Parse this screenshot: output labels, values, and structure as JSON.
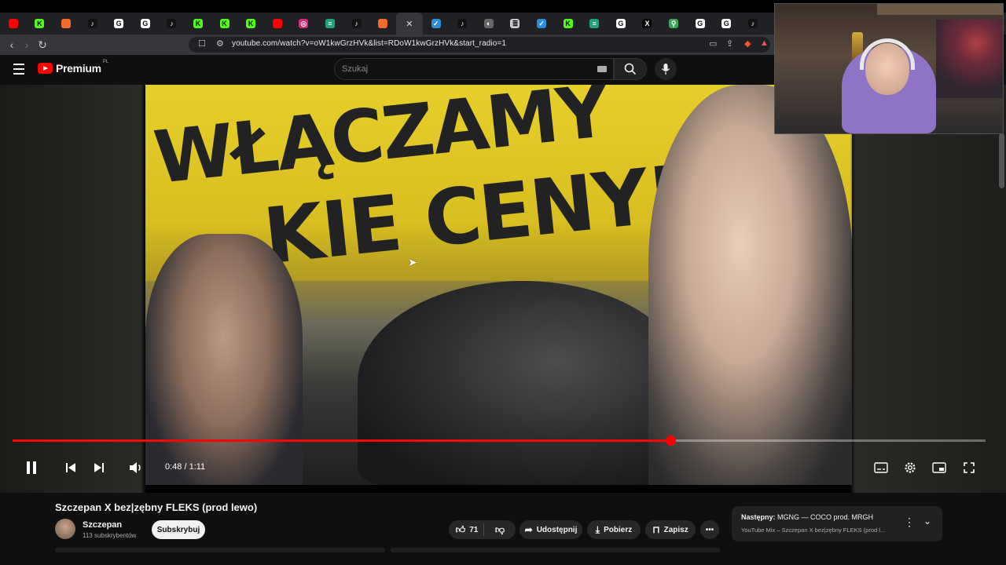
{
  "browser": {
    "tabs": [
      {
        "icon": "youtube-icon",
        "color": "#ff0000",
        "glyph": ""
      },
      {
        "icon": "kick-icon",
        "color": "#53fc18",
        "glyph": "K"
      },
      {
        "icon": "home-icon",
        "color": "#f26b2a",
        "glyph": ""
      },
      {
        "icon": "tiktok-icon",
        "color": "#111111",
        "glyph": "♪"
      },
      {
        "icon": "google-icon",
        "color": "#ffffff",
        "glyph": "G"
      },
      {
        "icon": "google-icon",
        "color": "#ffffff",
        "glyph": "G"
      },
      {
        "icon": "tiktok-icon",
        "color": "#111111",
        "glyph": "♪"
      },
      {
        "icon": "kick-icon",
        "color": "#53fc18",
        "glyph": "K"
      },
      {
        "icon": "kick-icon",
        "color": "#53fc18",
        "glyph": "K"
      },
      {
        "icon": "kick-icon",
        "color": "#53fc18",
        "glyph": "K"
      },
      {
        "icon": "youtube-icon",
        "color": "#ff0000",
        "glyph": ""
      },
      {
        "icon": "instagram-icon",
        "color": "#d62976",
        "glyph": "◎"
      },
      {
        "icon": "chat-icon",
        "color": "#1fa37a",
        "glyph": "≡"
      },
      {
        "icon": "tiktok-icon",
        "color": "#111111",
        "glyph": "♪"
      },
      {
        "icon": "home-icon",
        "color": "#f26b2a",
        "glyph": ""
      },
      {
        "icon": "active-tab",
        "color": "#35363a",
        "glyph": "✕"
      },
      {
        "icon": "bird-icon",
        "color": "#2a8fd8",
        "glyph": "✓"
      },
      {
        "icon": "tiktok-icon",
        "color": "#111111",
        "glyph": "♪"
      },
      {
        "icon": "globe-icon",
        "color": "#666666",
        "glyph": "◐"
      },
      {
        "icon": "stack-icon",
        "color": "#cccccc",
        "glyph": "≣"
      },
      {
        "icon": "bird-icon",
        "color": "#2a8fd8",
        "glyph": "✓"
      },
      {
        "icon": "kick-icon",
        "color": "#53fc18",
        "glyph": "K"
      },
      {
        "icon": "chat-icon",
        "color": "#1fa37a",
        "glyph": "≡"
      },
      {
        "icon": "google-icon",
        "color": "#ffffff",
        "glyph": "G"
      },
      {
        "icon": "x-icon",
        "color": "#000000",
        "glyph": "X"
      },
      {
        "icon": "maps-icon",
        "color": "#34a853",
        "glyph": "⚲"
      },
      {
        "icon": "google-icon",
        "color": "#ffffff",
        "glyph": "G"
      },
      {
        "icon": "google-icon",
        "color": "#ffffff",
        "glyph": "G"
      },
      {
        "icon": "tiktok-icon",
        "color": "#111111",
        "glyph": "♪"
      }
    ],
    "url": "youtube.com/watch?v=oW1kwGrzHVk&list=RDoW1kwGrzHVk&start_radio=1"
  },
  "header": {
    "logo_text": "Premium",
    "country": "PL",
    "search_placeholder": "Szukaj"
  },
  "player": {
    "sign_line1": "WŁĄCZAMY",
    "sign_line2": "KIE CENY!",
    "time": "0:48 / 1:11",
    "progress": 0.676,
    "progress_color": "#ff0000"
  },
  "video": {
    "title": "Szczepan X bez|zębny FLEKS (prod lewo)",
    "channel": "Szczepan",
    "subscribers": "113 subskrybentów",
    "subscribe_label": "Subskrybuj",
    "likes": "71",
    "share_label": "Udostępnij",
    "download_label": "Pobierz",
    "save_label": "Zapisz"
  },
  "up_next": {
    "label": "Następny:",
    "title": "MGNG — COCO prod. MRGH",
    "subtitle": "YouTube Mix – Szczepan X bez|zębny FLEKS (prod l..."
  }
}
